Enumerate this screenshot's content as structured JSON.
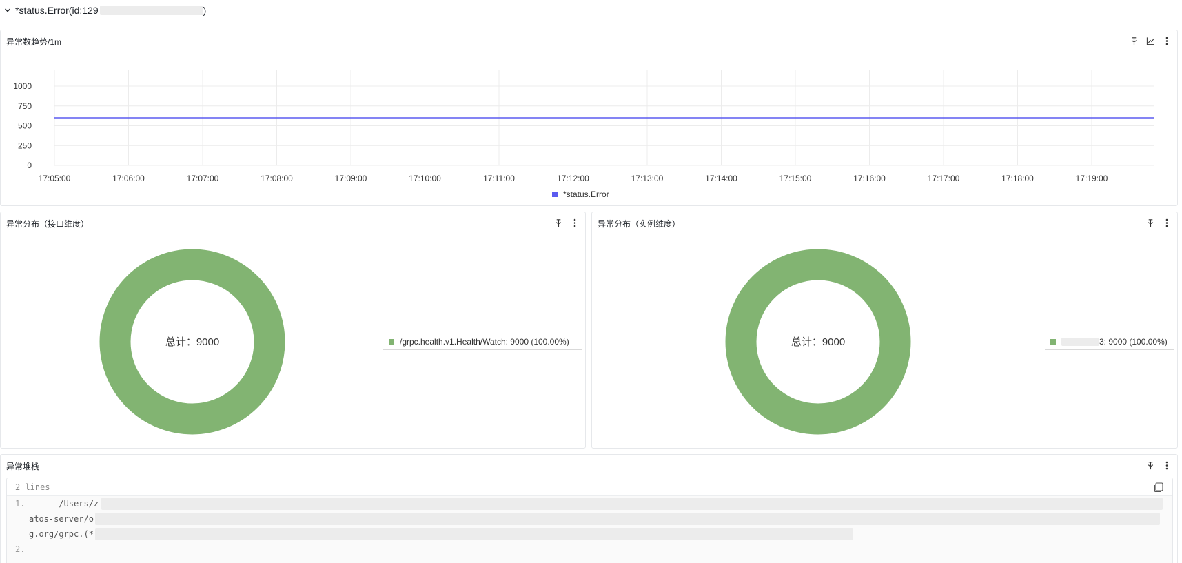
{
  "group": {
    "title": "*status.Error(id:129",
    "title_suffix": ")"
  },
  "trend_panel": {
    "title": "异常数趋势/1m",
    "tools": [
      "pin-icon",
      "line-chart-icon",
      "more-icon"
    ]
  },
  "chart_data": {
    "type": "line",
    "x": [
      "17:05:00",
      "17:06:00",
      "17:07:00",
      "17:08:00",
      "17:09:00",
      "17:10:00",
      "17:11:00",
      "17:12:00",
      "17:13:00",
      "17:14:00",
      "17:15:00",
      "17:16:00",
      "17:17:00",
      "17:18:00",
      "17:19:00"
    ],
    "series": [
      {
        "name": "*status.Error",
        "values": [
          600,
          600,
          600,
          600,
          600,
          600,
          600,
          600,
          600,
          600,
          600,
          600,
          600,
          600,
          600
        ],
        "color": "#5b5bf0"
      }
    ],
    "yticks": [
      0,
      250,
      500,
      750,
      1000
    ],
    "ylim": [
      0,
      1200
    ],
    "grid": true,
    "legend": "bottom-center"
  },
  "pie_api": {
    "title": "异常分布（接口维度）",
    "center_label": "总计：9000",
    "legend_text": "/grpc.health.v1.Health/Watch: 9000 (100.00%)",
    "value": 9000,
    "percent": 100,
    "color": "#82b472"
  },
  "pie_inst": {
    "title": "异常分布（实例维度）",
    "center_label": "总计：9000",
    "legend_text": "3: 9000 (100.00%)",
    "value": 9000,
    "percent": 100,
    "color": "#82b472"
  },
  "stack_panel": {
    "title": "异常堆栈",
    "lines_count_label": "2 lines",
    "lines": [
      {
        "num": "1.",
        "text": "      /Users/z"
      },
      {
        "num": "",
        "text": "atos-server/o"
      },
      {
        "num": "",
        "text": "g.org/grpc.(*"
      },
      {
        "num": "2.",
        "text": ""
      }
    ]
  }
}
